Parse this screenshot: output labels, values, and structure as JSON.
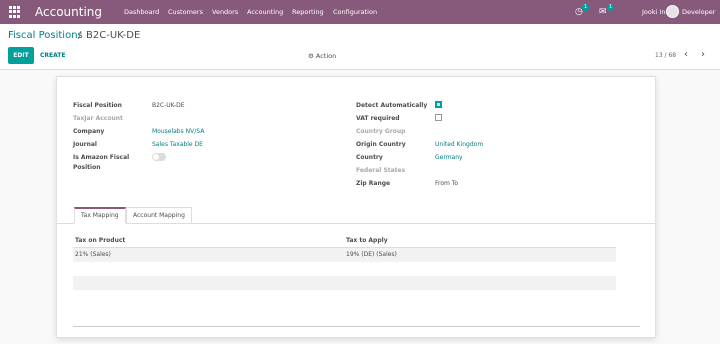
{
  "app": {
    "title": "Accounting",
    "menu": [
      "Dashboard",
      "Customers",
      "Vendors",
      "Accounting",
      "Reporting",
      "Configuration"
    ],
    "activity_badge": "1",
    "messages_badge": "1",
    "company": "Jooki Inc",
    "user": "Developer"
  },
  "breadcrumb": {
    "parent": "Fiscal Positions",
    "separator": "/",
    "current": "B2C-UK-DE"
  },
  "toolbar": {
    "edit_label": "EDIT",
    "create_label": "CREATE",
    "action_label": "Action",
    "pager": "13 / 68"
  },
  "form": {
    "left": {
      "fiscal_position_label": "Fiscal Position",
      "fiscal_position_value": "B2C-UK-DE",
      "taxjar_label": "TaxJar Account",
      "company_label": "Company",
      "company_value": "Mouselabs NV/SA",
      "journal_label": "Journal",
      "journal_value": "Sales Taxable DE",
      "amazon_label_1": "Is Amazon Fiscal",
      "amazon_label_2": "Position",
      "amazon_value": false
    },
    "right": {
      "detect_label": "Detect Automatically",
      "detect_value": true,
      "vat_label": "VAT required",
      "vat_value": false,
      "country_group_label": "Country Group",
      "origin_country_label": "Origin Country",
      "origin_country_value": "United Kingdom",
      "country_label": "Country",
      "country_value": "Germany",
      "federal_states_label": "Federal States",
      "zip_label": "Zip Range",
      "zip_value": "From To"
    }
  },
  "tabs": [
    "Tax Mapping",
    "Account Mapping"
  ],
  "table": {
    "headers": [
      "Tax on Product",
      "Tax to Apply"
    ],
    "rows": [
      [
        "21% (Sales)",
        "19% (DE) (Sales)"
      ]
    ]
  }
}
